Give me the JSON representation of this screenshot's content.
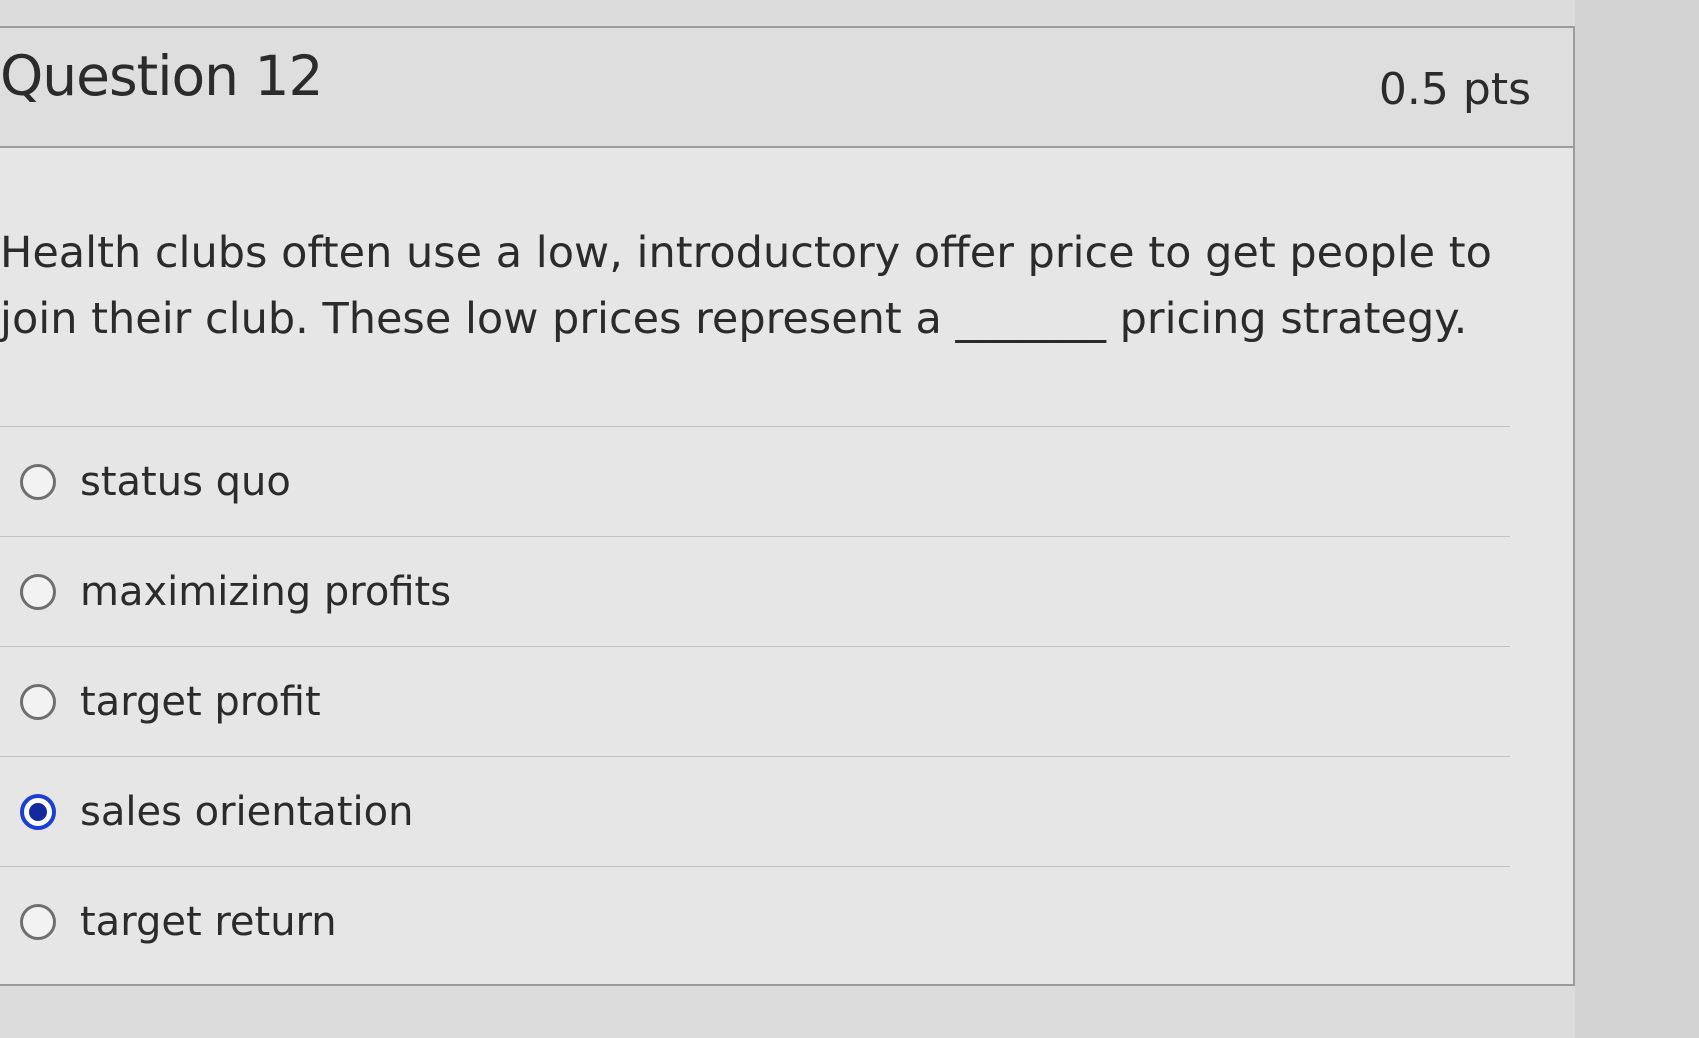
{
  "question": {
    "title": "Question 12",
    "points": "0.5 pts",
    "text": "Health clubs often use a low, introductory offer price to get people to join their club. These low prices represent a _______ pricing strategy."
  },
  "answers": [
    {
      "label": "status quo",
      "selected": false
    },
    {
      "label": "maximizing profits",
      "selected": false
    },
    {
      "label": "target profit",
      "selected": false
    },
    {
      "label": "sales orientation",
      "selected": true
    },
    {
      "label": "target return",
      "selected": false
    }
  ],
  "colors": {
    "selected_radio": "#1b3fd6",
    "card_background": "#e6e6e6",
    "border": "#9c9c9c"
  }
}
